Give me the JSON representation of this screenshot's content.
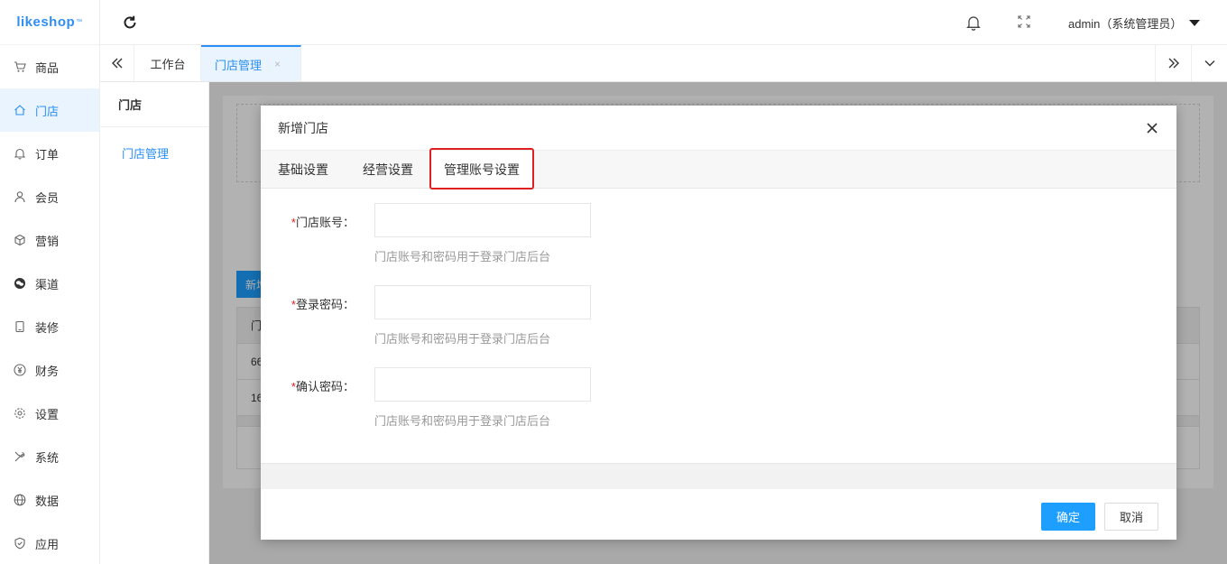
{
  "logo": {
    "text": "likeshop",
    "tm": "™"
  },
  "sidebar": {
    "items": [
      {
        "label": "商品",
        "icon": "cart-icon"
      },
      {
        "label": "门店",
        "icon": "home-icon"
      },
      {
        "label": "订单",
        "icon": "bell-icon"
      },
      {
        "label": "会员",
        "icon": "user-icon"
      },
      {
        "label": "营销",
        "icon": "cube-icon"
      },
      {
        "label": "渠道",
        "icon": "wechat-icon"
      },
      {
        "label": "装修",
        "icon": "tablet-icon"
      },
      {
        "label": "财务",
        "icon": "yen-icon"
      },
      {
        "label": "设置",
        "icon": "gear-icon"
      },
      {
        "label": "系统",
        "icon": "tools-icon"
      },
      {
        "label": "数据",
        "icon": "globe-icon"
      },
      {
        "label": "应用",
        "icon": "shield-icon"
      }
    ],
    "active_index": 1
  },
  "header": {
    "user": "admin（系统管理员）"
  },
  "tabs": {
    "home": "工作台",
    "active": "门店管理",
    "close": "×"
  },
  "subnav": {
    "title": "门店",
    "item": "门店管理"
  },
  "background": {
    "new_button": "新增",
    "rows": [
      "门",
      "66",
      "16"
    ]
  },
  "modal": {
    "title": "新增门店",
    "tabs": [
      "基础设置",
      "经营设置",
      "管理账号设置"
    ],
    "active_tab": 2,
    "fields": [
      {
        "required": "*",
        "label": "门店账号：",
        "value": "",
        "hint": "门店账号和密码用于登录门店后台"
      },
      {
        "required": "*",
        "label": "登录密码：",
        "value": "",
        "hint": "门店账号和密码用于登录门店后台"
      },
      {
        "required": "*",
        "label": "确认密码：",
        "value": "",
        "hint": "门店账号和密码用于登录门店后台"
      }
    ],
    "ok": "确定",
    "cancel": "取消"
  },
  "colors": {
    "accent": "#1e9fff",
    "highlight": "#e02020",
    "active_bg": "#eaf4ff"
  }
}
